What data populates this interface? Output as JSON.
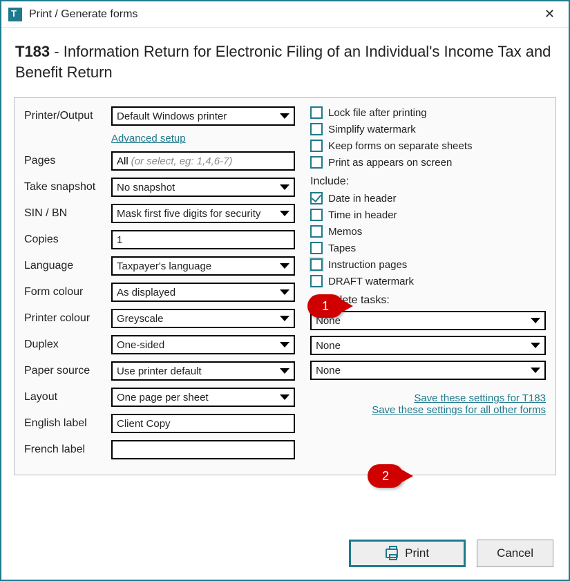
{
  "titlebar": {
    "title": "Print / Generate forms"
  },
  "header": {
    "code": "T183",
    "rest": " - Information Return for Electronic Filing of an Individual's Income Tax and Benefit Return"
  },
  "left": {
    "printer_label": "Printer/Output",
    "printer_value": "Default Windows printer",
    "advanced_link": "Advanced setup",
    "pages_label": "Pages",
    "pages_value": "All",
    "pages_hint": "(or select, eg: 1,4,6-7)",
    "snapshot_label": "Take snapshot",
    "snapshot_value": "No snapshot",
    "sin_label": "SIN / BN",
    "sin_value": "Mask first five digits for security",
    "copies_label": "Copies",
    "copies_value": "1",
    "language_label": "Language",
    "language_value": "Taxpayer's language",
    "formcolour_label": "Form colour",
    "formcolour_value": "As displayed",
    "printercolour_label": "Printer colour",
    "printercolour_value": "Greyscale",
    "duplex_label": "Duplex",
    "duplex_value": "One-sided",
    "papersource_label": "Paper source",
    "papersource_value": "Use printer default",
    "layout_label": "Layout",
    "layout_value": "One page per sheet",
    "english_label": "English label",
    "english_value": "Client Copy",
    "french_label": "French label",
    "french_value": ""
  },
  "right": {
    "opts": {
      "lock": "Lock file after printing",
      "simplify": "Simplify watermark",
      "separate": "Keep forms on separate sheets",
      "asappears": "Print as appears on screen"
    },
    "include_label": "Include:",
    "include": {
      "date": "Date in header",
      "time": "Time in header",
      "memos": "Memos",
      "tapes": "Tapes",
      "instruction": "Instruction pages",
      "draft": "DRAFT watermark"
    },
    "tasks_label": "Complete tasks:",
    "task1": "None",
    "task2": "None",
    "task3": "None",
    "save1": "Save these settings for T183",
    "save2": "Save these settings for all other forms"
  },
  "footer": {
    "print": "Print",
    "cancel": "Cancel"
  },
  "callouts": {
    "c1": "1",
    "c2": "2"
  }
}
